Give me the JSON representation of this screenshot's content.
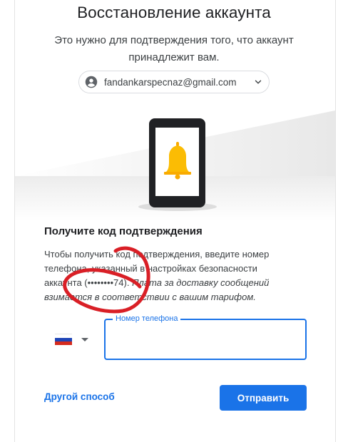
{
  "header": {
    "title": "Восстановление аккаунта",
    "subtitle": "Это нужно для подтверждения того, что аккаунт принадлежит вам."
  },
  "account": {
    "email": "fandankarspecnaz@gmail.com",
    "avatar_icon": "account-circle-icon",
    "chevron_icon": "chevron-down-icon"
  },
  "illustration": {
    "icon": "phone-bell-icon",
    "bell_color": "#fbbc04",
    "phone_color": "#202124"
  },
  "section": {
    "heading": "Получите код подтверждения",
    "description_lines": [
      "Чтобы получить код подтверждения, введите номер",
      "телефона, указанный в настройках безопасности",
      "аккаунта (••••••••74)."
    ],
    "description_italic_part1": " Плата за доставку сообщений",
    "description_italic_part2": "взимается в соответствии с вашим тарифом."
  },
  "phone_input": {
    "label": "Номер телефона",
    "value": "",
    "country_flag": "russia-flag-icon",
    "border_color": "#1a73e8"
  },
  "actions": {
    "other_method": "Другой способ",
    "send": "Отправить",
    "accent": "#1a73e8"
  },
  "annotation": {
    "color": "#d91f26"
  }
}
